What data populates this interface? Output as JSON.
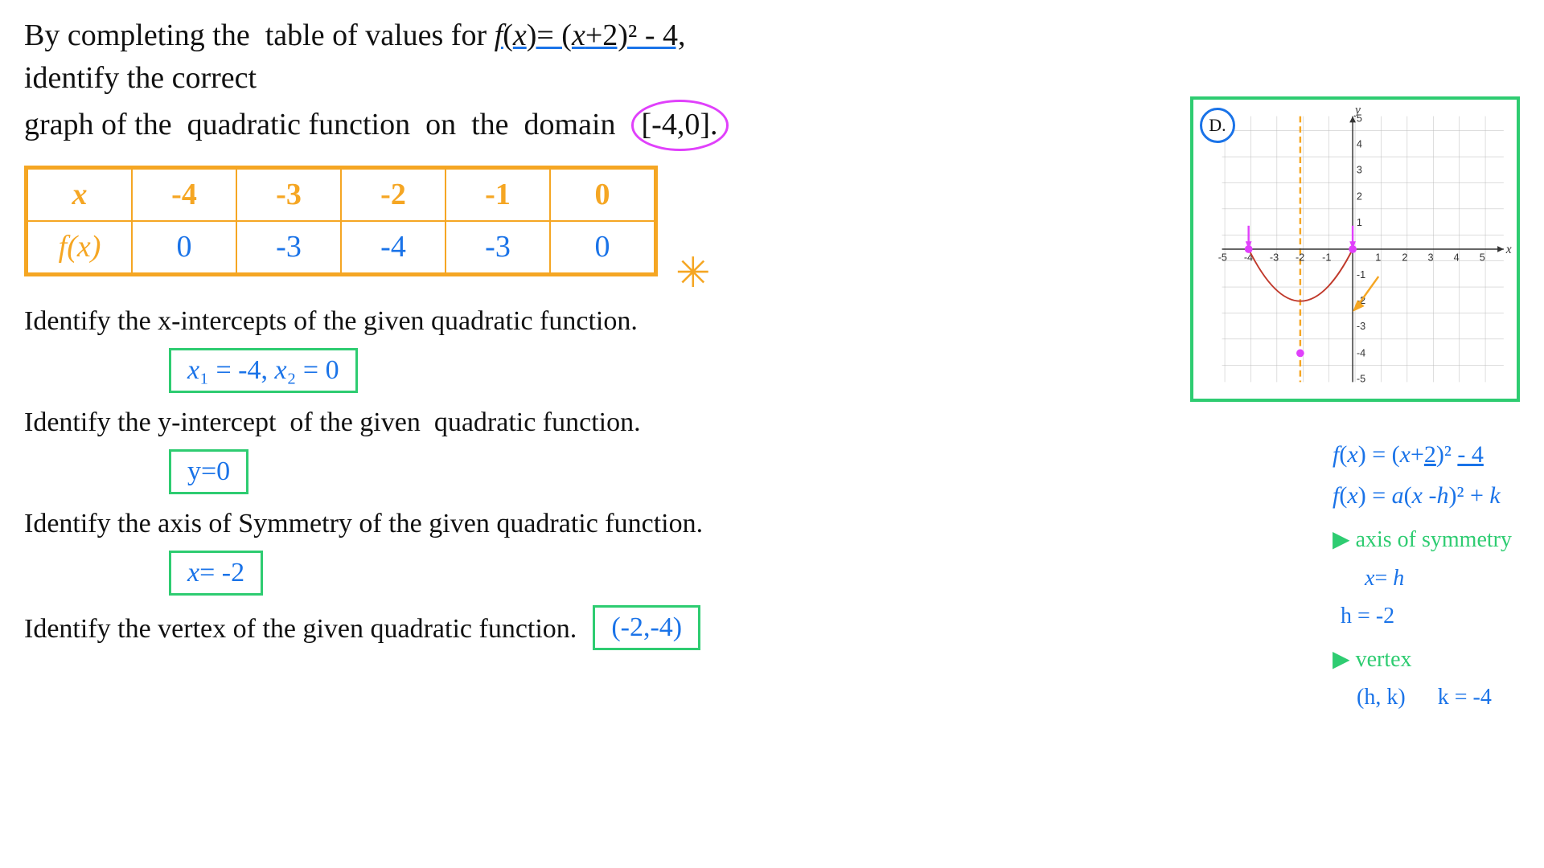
{
  "problem": {
    "statement_line1": "By completing the  table of values for f(x)= (x+2)² - 4, identify the correct",
    "statement_line2": "graph of the  quadratic function  on  the  domain",
    "domain": "[-4,0].",
    "fx_label": "f(x)=",
    "fx_eq": "(x+2)² - 4"
  },
  "table": {
    "headers": [
      "x",
      "-4",
      "-3",
      "-2",
      "-1",
      "0"
    ],
    "row_label": "f(x)",
    "row_values": [
      "0",
      "-3",
      "-4",
      "-3",
      "0"
    ]
  },
  "sections": [
    {
      "question": "Identify the x-intercepts of the given quadratic function.",
      "answer": "x₁ = -4, x₂ = 0"
    },
    {
      "question": "Identify the y-intercept  of the given  quadratic function.",
      "answer": "y=0"
    },
    {
      "question": "Identify the axis of Symmetry of the given quadratic function.",
      "answer": "x= -2"
    },
    {
      "question": "Identify the vertex of the given quadratic function.",
      "answer": "(-2,-4)"
    }
  ],
  "graph": {
    "label": "D.",
    "x_min": -5,
    "x_max": 5,
    "y_min": -5,
    "y_max": 5
  },
  "formulas": {
    "line1": "f(x) = (x+2)² - 4",
    "line2": "f(x) = a(x - h)² + k",
    "axis_label": "▶ axis of symmetry",
    "axis_eq": "x= h",
    "h_val": "h = -2",
    "vertex_label": "▶ vertex",
    "vertex_form": "(h, k)",
    "k_val": "k = -4"
  },
  "asterisk": "✳"
}
